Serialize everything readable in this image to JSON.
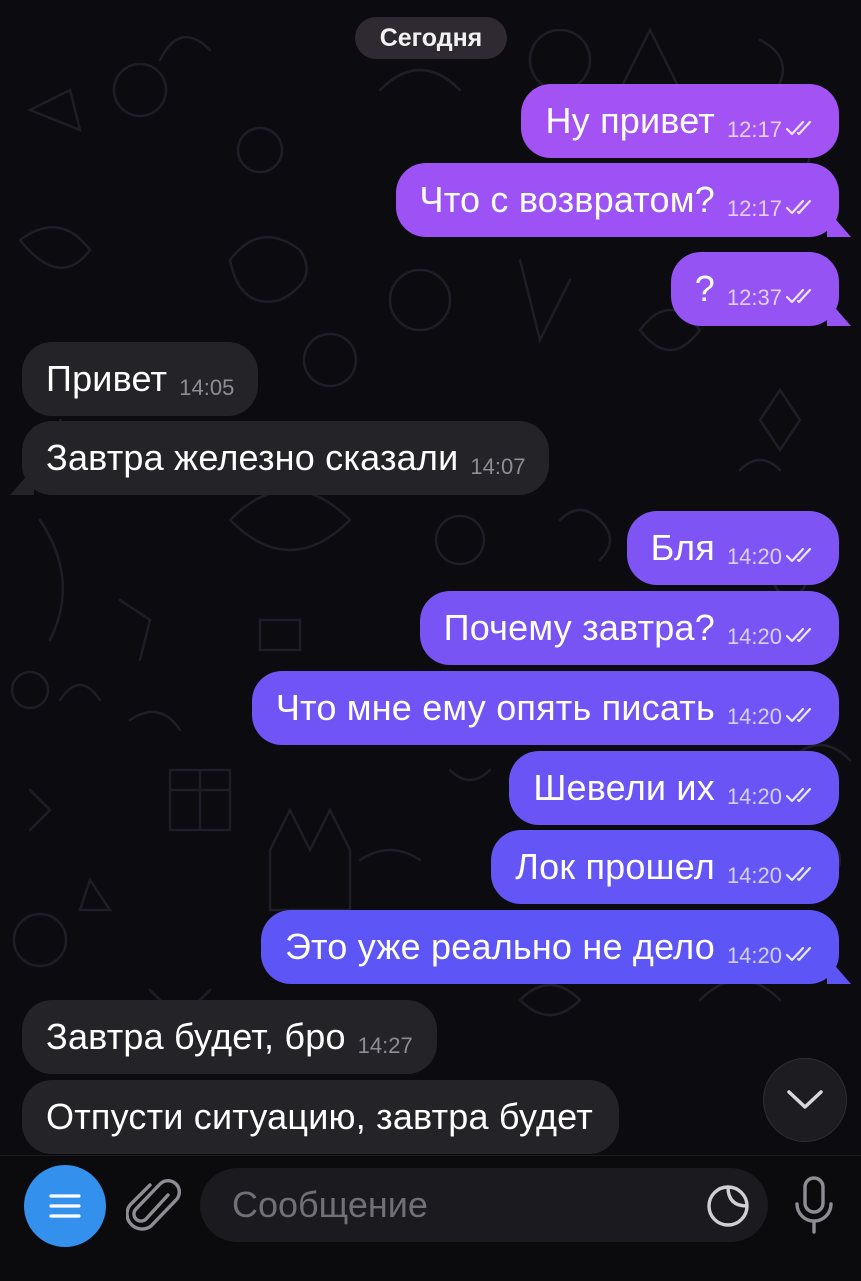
{
  "date_label": "Сегодня",
  "colors": {
    "outgoing_top": "#a352f4",
    "outgoing_bottom": "#5d55f6",
    "incoming": "#242328",
    "accent": "#3390ec"
  },
  "messages": [
    {
      "dir": "out",
      "text": "Ну привет",
      "time": "12:17"
    },
    {
      "dir": "out",
      "text": "Что с возвратом?",
      "time": "12:17"
    },
    {
      "dir": "out",
      "text": "?",
      "time": "12:37"
    },
    {
      "dir": "in",
      "text": "Привет",
      "time": "14:05"
    },
    {
      "dir": "in",
      "text": "Завтра железно сказали",
      "time": "14:07"
    },
    {
      "dir": "out",
      "text": "Бля",
      "time": "14:20"
    },
    {
      "dir": "out",
      "text": "Почему завтра?",
      "time": "14:20"
    },
    {
      "dir": "out",
      "text": "Что мне ему опять писать",
      "time": "14:20"
    },
    {
      "dir": "out",
      "text": "Шевели их",
      "time": "14:20"
    },
    {
      "dir": "out",
      "text": "Лок прошел",
      "time": "14:20"
    },
    {
      "dir": "out",
      "text": "Это уже реально не дело",
      "time": "14:20"
    },
    {
      "dir": "in",
      "text": "Завтра будет, бро",
      "time": "14:27"
    },
    {
      "dir": "in",
      "text": "Отпусти ситуацию, завтра будет",
      "time": ""
    }
  ],
  "composer": {
    "placeholder": "Сообщение",
    "menu_icon": "menu-icon",
    "attach_icon": "paperclip-icon",
    "sticker_icon": "sticker-icon",
    "mic_icon": "microphone-icon"
  },
  "scroll_down_icon": "chevron-down-icon"
}
